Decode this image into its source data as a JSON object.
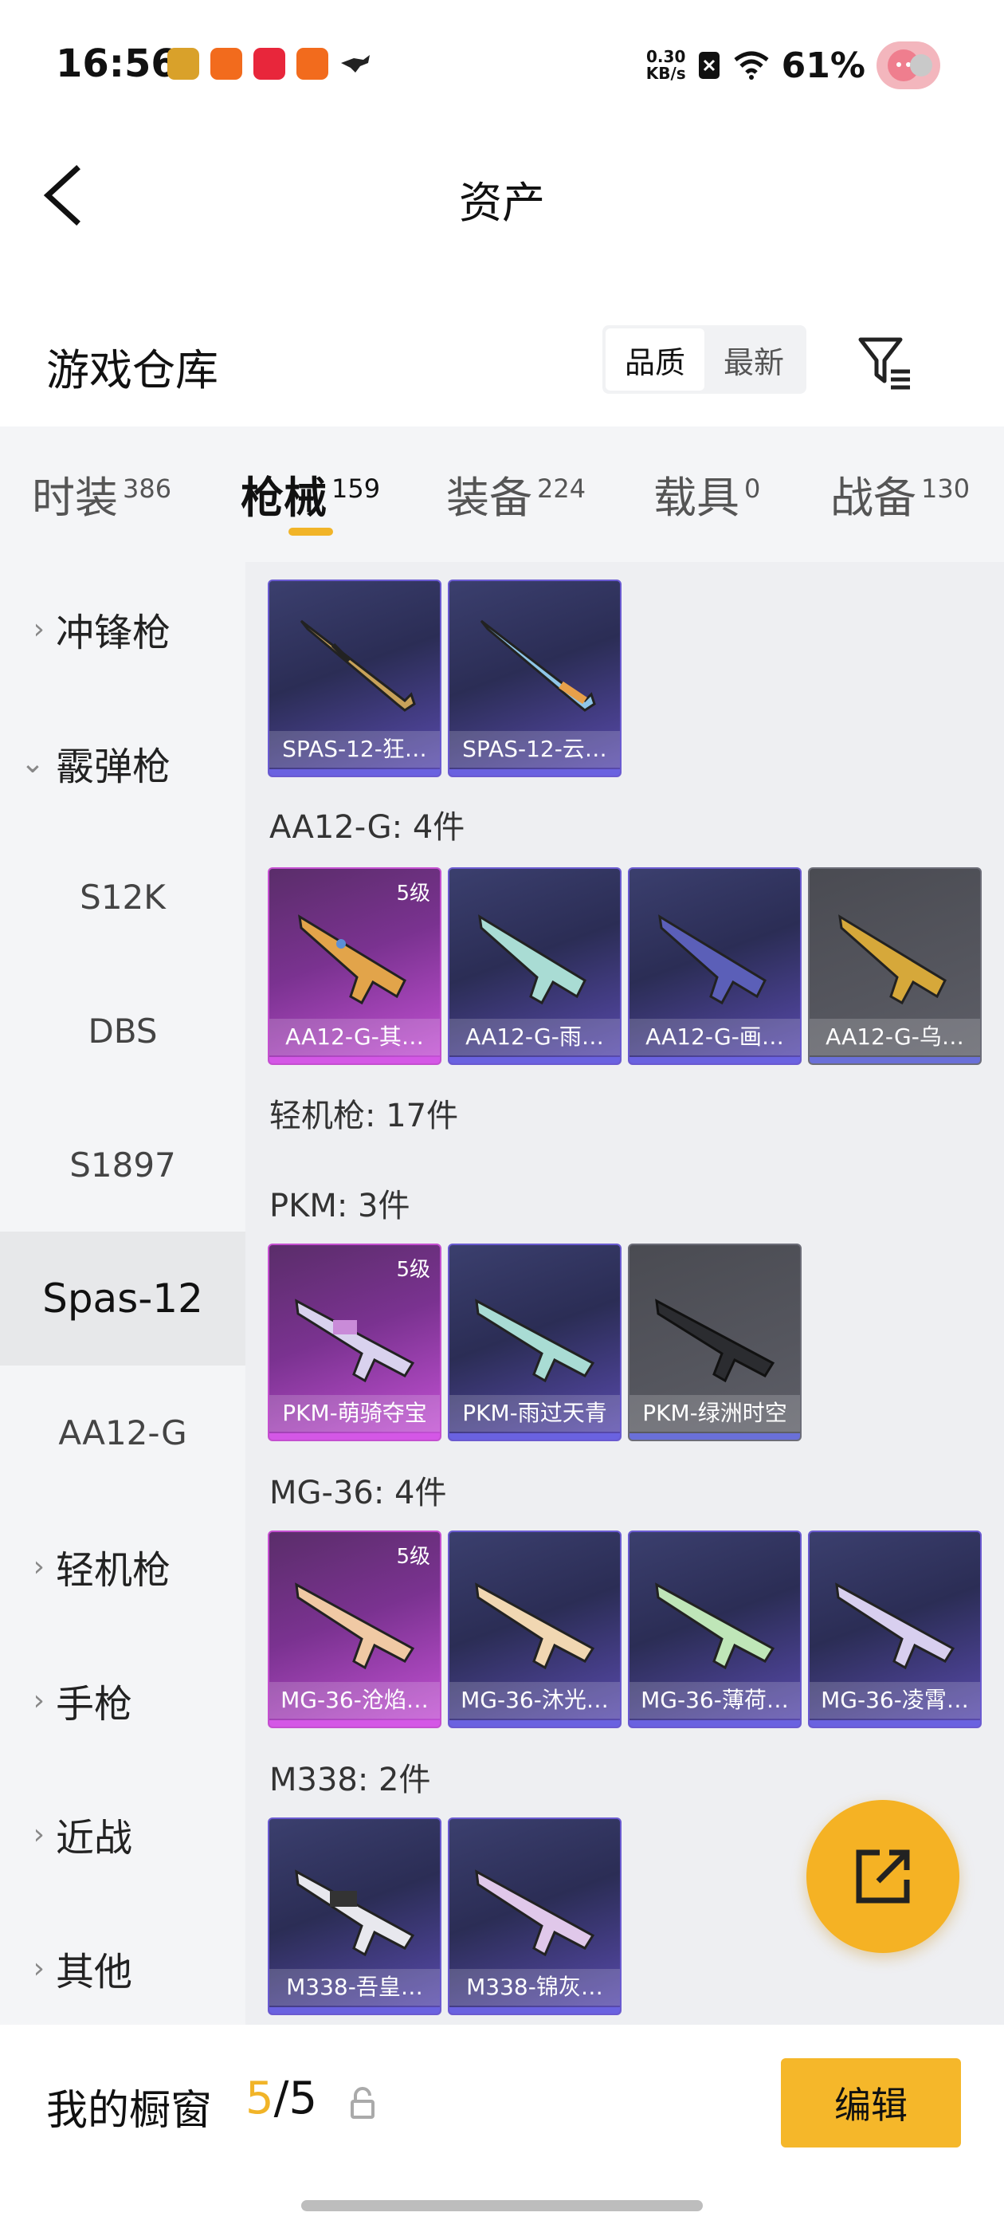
{
  "status_bar": {
    "time": "16:56",
    "net_speed": "0.30",
    "net_unit": "KB/s",
    "battery": "61%",
    "apps": [
      {
        "icon": "app-game-icon",
        "label": "",
        "color": "#d9a12a"
      },
      {
        "icon": "app-kuaishou-icon",
        "label": "",
        "color": "#f26b1d"
      },
      {
        "icon": "app-xiaohongshu-icon",
        "label": "",
        "color": "#e8263b"
      },
      {
        "icon": "app-kuaishou2-icon",
        "label": "",
        "color": "#f26b1d"
      },
      {
        "icon": "app-misc-icon",
        "label": "",
        "color": "#333333"
      }
    ]
  },
  "header": {
    "title": "资产"
  },
  "warehouse": {
    "title": "游戏仓库",
    "sort_options": [
      "品质",
      "最新"
    ],
    "sort_selected": "品质"
  },
  "tabs": [
    {
      "label": "时装",
      "count": "386"
    },
    {
      "label": "枪械",
      "count": "159",
      "active": true
    },
    {
      "label": "装备",
      "count": "224"
    },
    {
      "label": "载具",
      "count": "0"
    },
    {
      "label": "战备",
      "count": "130"
    }
  ],
  "sidebar": {
    "items": [
      {
        "label": "冲锋枪",
        "chevron": "›"
      },
      {
        "label": "霰弹枪",
        "chevron": "⌄"
      },
      {
        "label": "S12K"
      },
      {
        "label": "DBS"
      },
      {
        "label": "S1897"
      },
      {
        "label": "Spas-12",
        "active": true
      },
      {
        "label": "AA12-G"
      },
      {
        "label": "轻机枪",
        "chevron": "›"
      },
      {
        "label": "手枪",
        "chevron": "›"
      },
      {
        "label": "近战",
        "chevron": "›"
      },
      {
        "label": "其他",
        "chevron": "›"
      }
    ]
  },
  "groups": {
    "spas": {
      "cards": [
        {
          "name": "SPAS-12-狂…",
          "rarity": "purple"
        },
        {
          "name": "SPAS-12-云…",
          "rarity": "purple"
        }
      ]
    },
    "aa12": {
      "label": "AA12-G: 4件",
      "cards": [
        {
          "name": "AA12-G-其…",
          "rarity": "magenta",
          "level": "5级"
        },
        {
          "name": "AA12-G-雨…",
          "rarity": "purple"
        },
        {
          "name": "AA12-G-画…",
          "rarity": "purple"
        },
        {
          "name": "AA12-G-乌…",
          "rarity": "gray"
        }
      ]
    },
    "lmg_label": "轻机枪: 17件",
    "pkm": {
      "label": "PKM: 3件",
      "cards": [
        {
          "name": "PKM-萌骑夺宝",
          "rarity": "magenta",
          "level": "5级"
        },
        {
          "name": "PKM-雨过天青",
          "rarity": "purple"
        },
        {
          "name": "PKM-绿洲时空",
          "rarity": "gray"
        }
      ]
    },
    "mg36": {
      "label": "MG-36: 4件",
      "cards": [
        {
          "name": "MG-36-沧焰…",
          "rarity": "magenta",
          "level": "5级"
        },
        {
          "name": "MG-36-沐光…",
          "rarity": "purple"
        },
        {
          "name": "MG-36-薄荷…",
          "rarity": "purple"
        },
        {
          "name": "MG-36-凌霄…",
          "rarity": "purple"
        }
      ]
    },
    "m338": {
      "label": "M338: 2件",
      "cards": [
        {
          "name": "M338-吾皇…",
          "rarity": "purple"
        },
        {
          "name": "M338-锦灰…",
          "rarity": "purple"
        }
      ]
    }
  },
  "bottom": {
    "label": "我的橱窗",
    "current": "5",
    "total": "/5",
    "edit_label": "编辑"
  },
  "colors": {
    "accent": "#f1b428",
    "fab": "#f5b224"
  }
}
